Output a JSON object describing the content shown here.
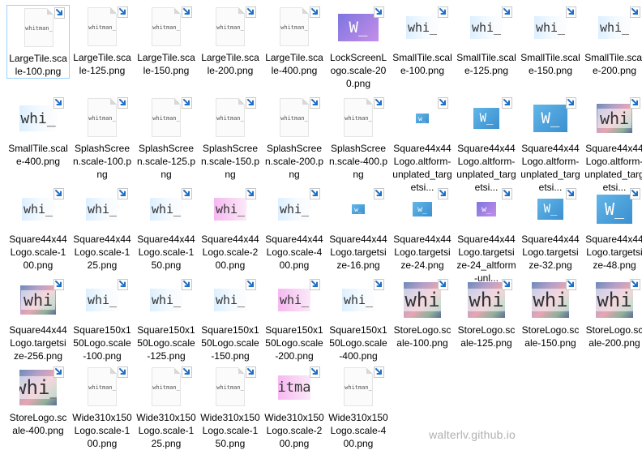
{
  "watermark": "walterlv.github.io",
  "files": [
    {
      "label": "LargeTile.scale-100.png",
      "tile": "whitman",
      "text": "whitman_",
      "w": 34,
      "h": 20,
      "selected": true
    },
    {
      "label": "LargeTile.scale-125.png",
      "tile": "whitman",
      "text": "whitman_",
      "w": 34,
      "h": 20
    },
    {
      "label": "LargeTile.scale-150.png",
      "tile": "whitman",
      "text": "whitman_",
      "w": 34,
      "h": 20
    },
    {
      "label": "LargeTile.scale-200.png",
      "tile": "whitman",
      "text": "whitman_",
      "w": 34,
      "h": 20
    },
    {
      "label": "LargeTile.scale-400.png",
      "tile": "whitman",
      "text": "whitman_",
      "w": 34,
      "h": 20
    },
    {
      "label": "LockScreenLogo.scale-200.png",
      "tile": "purple",
      "text": "W_",
      "w": 50,
      "h": 34
    },
    {
      "label": "SmallTile.scale-100.png",
      "tile": "light",
      "text": "whi_",
      "w": 40,
      "h": 28
    },
    {
      "label": "SmallTile.scale-125.png",
      "tile": "light",
      "text": "whi_",
      "w": 40,
      "h": 28
    },
    {
      "label": "SmallTile.scale-150.png",
      "tile": "light",
      "text": "whi_",
      "w": 40,
      "h": 28
    },
    {
      "label": "SmallTile.scale-200.png",
      "tile": "light",
      "text": "whi_",
      "w": 40,
      "h": 28
    },
    {
      "label": "SmallTile.scale-400.png",
      "tile": "light",
      "text": "whi_",
      "w": 46,
      "h": 32
    },
    {
      "label": "SplashScreen.scale-100.png",
      "tile": "whitman",
      "text": "whitman_",
      "w": 40,
      "h": 16
    },
    {
      "label": "SplashScreen.scale-125.png",
      "tile": "whitman",
      "text": "whitman_",
      "w": 40,
      "h": 16
    },
    {
      "label": "SplashScreen.scale-150.png",
      "tile": "whitman",
      "text": "whitman_",
      "w": 40,
      "h": 16
    },
    {
      "label": "SplashScreen.scale-200.png",
      "tile": "whitman",
      "text": "whitman_",
      "w": 40,
      "h": 16
    },
    {
      "label": "SplashScreen.scale-400.png",
      "tile": "whitman",
      "text": "whitman_",
      "w": 40,
      "h": 16
    },
    {
      "label": "Square44x44Logo.altform-unplated_targetsi...",
      "tile": "blue",
      "text": "w_",
      "w": 16,
      "h": 12
    },
    {
      "label": "Square44x44Logo.altform-unplated_targetsi...",
      "tile": "blue",
      "text": "W_",
      "w": 32,
      "h": 26
    },
    {
      "label": "Square44x44Logo.altform-unplated_targetsi...",
      "tile": "blue",
      "text": "W_",
      "w": 42,
      "h": 34
    },
    {
      "label": "Square44x44Logo.altform-unplated_targetsi...",
      "tile": "photo",
      "text": "whi",
      "w": 44,
      "h": 36
    },
    {
      "label": "Square44x44Logo.scale-100.png",
      "tile": "light",
      "text": "whi_",
      "w": 40,
      "h": 28
    },
    {
      "label": "Square44x44Logo.scale-125.png",
      "tile": "light",
      "text": "whi_",
      "w": 40,
      "h": 28
    },
    {
      "label": "Square44x44Logo.scale-150.png",
      "tile": "light",
      "text": "whi_",
      "w": 40,
      "h": 28
    },
    {
      "label": "Square44x44Logo.scale-200.png",
      "tile": "pink",
      "text": "whi_",
      "w": 40,
      "h": 28
    },
    {
      "label": "Square44x44Logo.scale-400.png",
      "tile": "light",
      "text": "whi_",
      "w": 40,
      "h": 28
    },
    {
      "label": "Square44x44Logo.targetsize-16.png",
      "tile": "blue",
      "text": "w_",
      "w": 16,
      "h": 12
    },
    {
      "label": "Square44x44Logo.targetsize-24.png",
      "tile": "blue",
      "text": "w_",
      "w": 24,
      "h": 18
    },
    {
      "label": "Square44x44Logo.targetsize-24_altform-unl...",
      "tile": "purple",
      "text": "w_",
      "w": 24,
      "h": 18
    },
    {
      "label": "Square44x44Logo.targetsize-32.png",
      "tile": "blue",
      "text": "W_",
      "w": 32,
      "h": 26
    },
    {
      "label": "Square44x44Logo.targetsize-48.png",
      "tile": "blue",
      "text": "W_",
      "w": 44,
      "h": 36
    },
    {
      "label": "Square44x44Logo.targetsize-256.png",
      "tile": "photo",
      "text": "whi",
      "w": 44,
      "h": 36
    },
    {
      "label": "Square150x150Logo.scale-100.png",
      "tile": "light",
      "text": "whi_",
      "w": 40,
      "h": 28
    },
    {
      "label": "Square150x150Logo.scale-125.png",
      "tile": "light",
      "text": "whi_",
      "w": 40,
      "h": 28
    },
    {
      "label": "Square150x150Logo.scale-150.png",
      "tile": "light",
      "text": "whi_",
      "w": 40,
      "h": 28
    },
    {
      "label": "Square150x150Logo.scale-200.png",
      "tile": "pink",
      "text": "whi_",
      "w": 40,
      "h": 28
    },
    {
      "label": "Square150x150Logo.scale-400.png",
      "tile": "light",
      "text": "whi_",
      "w": 40,
      "h": 28
    },
    {
      "label": "StoreLogo.scale-100.png",
      "tile": "photo",
      "text": "whi",
      "w": 46,
      "h": 44
    },
    {
      "label": "StoreLogo.scale-125.png",
      "tile": "photo",
      "text": "whi",
      "w": 46,
      "h": 44
    },
    {
      "label": "StoreLogo.scale-150.png",
      "tile": "photo",
      "text": "whi",
      "w": 46,
      "h": 44
    },
    {
      "label": "StoreLogo.scale-200.png",
      "tile": "photo",
      "text": "whi",
      "w": 46,
      "h": 44
    },
    {
      "label": "StoreLogo.scale-400.png",
      "tile": "photo",
      "text": "whi_",
      "w": 46,
      "h": 44
    },
    {
      "label": "Wide310x150Logo.scale-100.png",
      "tile": "whitman",
      "text": "whitman_",
      "w": 40,
      "h": 20
    },
    {
      "label": "Wide310x150Logo.scale-125.png",
      "tile": "whitman",
      "text": "whitman_",
      "w": 40,
      "h": 20
    },
    {
      "label": "Wide310x150Logo.scale-150.png",
      "tile": "whitman",
      "text": "whitman_",
      "w": 40,
      "h": 20
    },
    {
      "label": "Wide310x150Logo.scale-200.png",
      "tile": "pink",
      "text": "whitman_",
      "w": 40,
      "h": 30
    },
    {
      "label": "Wide310x150Logo.scale-400.png",
      "tile": "whitman",
      "text": "whitman_",
      "w": 40,
      "h": 20
    }
  ]
}
